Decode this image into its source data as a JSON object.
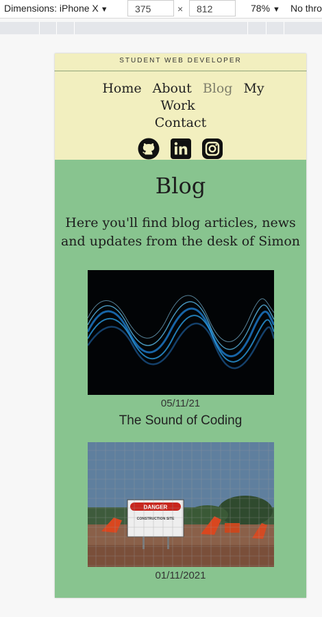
{
  "devtools": {
    "device_label": "Dimensions: iPhone X",
    "width_value": "375",
    "height_value": "812",
    "times": "×",
    "zoom": "78%",
    "throttle": "No thro"
  },
  "site": {
    "tagline": "STUDENT WEB DEVELOPER",
    "nav": [
      "Home",
      "About",
      "Blog",
      "My Work",
      "Contact"
    ],
    "active_nav": "Blog",
    "socials": [
      "github-icon",
      "linkedin-icon",
      "instagram-icon"
    ],
    "page_title": "Blog",
    "intro": "Here you'll find blog articles, news and updates from the desk of Simon",
    "colors": {
      "header_bg": "#f2efbf",
      "main_bg": "#88c48f",
      "active_nav": "#7d7d6a"
    }
  },
  "posts": [
    {
      "date": "05/11/21",
      "title": "The Sound of Coding",
      "image": "blue-light-waves-image"
    },
    {
      "date": "01/11/2021",
      "title": "",
      "image": "construction-site-danger-sign-image",
      "sign_top": "DANGER",
      "sign_text": "CONSTRUCTION SITE"
    }
  ]
}
